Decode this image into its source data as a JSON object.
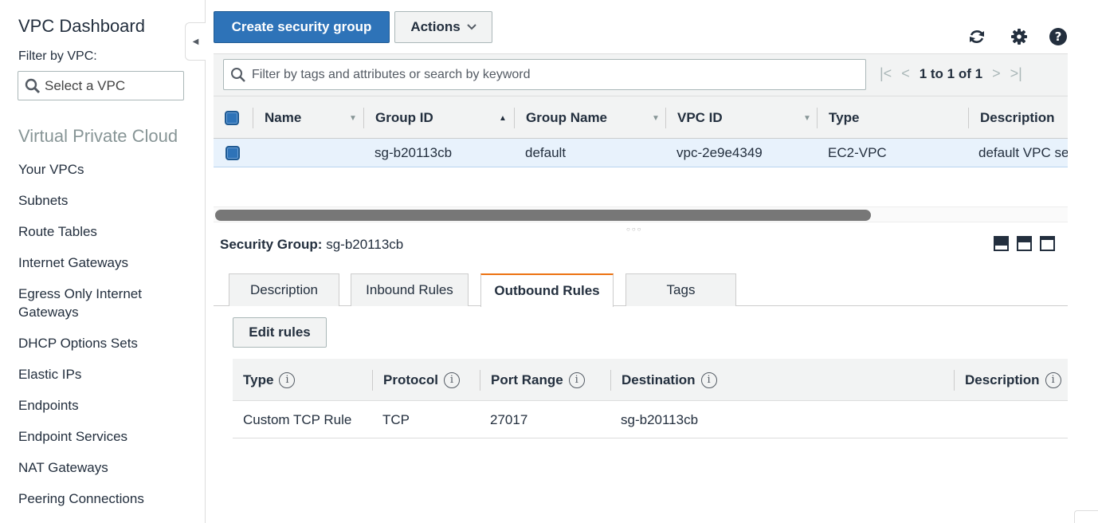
{
  "sidebar": {
    "title": "VPC Dashboard",
    "filter_label": "Filter by VPC:",
    "select_placeholder": "Select a VPC",
    "section": "Virtual Private Cloud",
    "items": [
      {
        "label": "Your VPCs"
      },
      {
        "label": "Subnets"
      },
      {
        "label": "Route Tables"
      },
      {
        "label": "Internet Gateways"
      },
      {
        "label": "Egress Only Internet Gateways"
      },
      {
        "label": "DHCP Options Sets"
      },
      {
        "label": "Elastic IPs"
      },
      {
        "label": "Endpoints"
      },
      {
        "label": "Endpoint Services"
      },
      {
        "label": "NAT Gateways"
      },
      {
        "label": "Peering Connections"
      }
    ]
  },
  "toolbar": {
    "create_label": "Create security group",
    "actions_label": "Actions"
  },
  "filter": {
    "placeholder": "Filter by tags and attributes or search by keyword",
    "pager": "1 to 1 of 1"
  },
  "table": {
    "columns": {
      "name": "Name",
      "group_id": "Group ID",
      "group_name": "Group Name",
      "vpc_id": "VPC ID",
      "type": "Type",
      "description": "Description"
    },
    "rows": [
      {
        "name": "",
        "group_id": "sg-b20113cb",
        "group_name": "default",
        "vpc_id": "vpc-2e9e4349",
        "type": "EC2-VPC",
        "description": "default VPC se"
      }
    ]
  },
  "detail": {
    "label": "Security Group:",
    "group_id": "sg-b20113cb",
    "tabs": [
      {
        "label": "Description"
      },
      {
        "label": "Inbound Rules"
      },
      {
        "label": "Outbound Rules",
        "active": true
      },
      {
        "label": "Tags"
      }
    ],
    "edit_label": "Edit rules",
    "rules_columns": {
      "type": "Type",
      "protocol": "Protocol",
      "port_range": "Port Range",
      "destination": "Destination",
      "description": "Description"
    },
    "rules": [
      {
        "type": "Custom TCP Rule",
        "protocol": "TCP",
        "port_range": "27017",
        "destination": "sg-b20113cb",
        "description": ""
      }
    ]
  }
}
